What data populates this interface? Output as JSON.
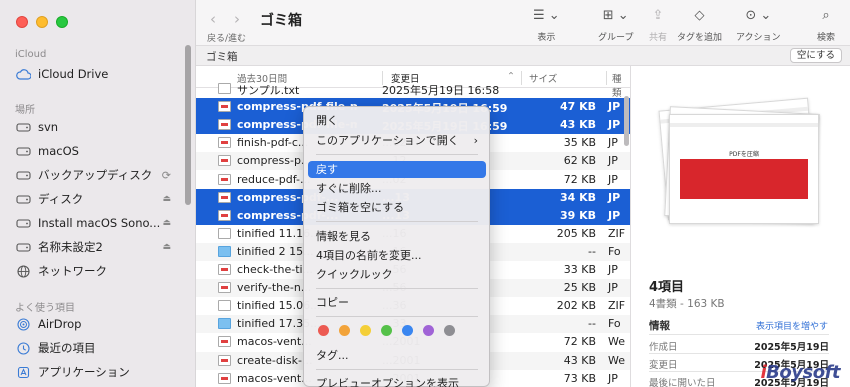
{
  "sidebar": {
    "sections": {
      "icloud": "iCloud",
      "places": "場所",
      "favorites": "よく使う項目"
    },
    "icloud_items": [
      {
        "label": "iCloud Drive",
        "icon": "cloud-icon"
      }
    ],
    "places_items": [
      {
        "label": "svn",
        "icon": "drive-icon"
      },
      {
        "label": "macOS",
        "icon": "drive-icon"
      },
      {
        "label": "バックアップディスク",
        "icon": "drive-icon"
      },
      {
        "label": "ディスク",
        "icon": "drive-icon"
      },
      {
        "label": "Install macOS Sono...",
        "icon": "drive-icon"
      },
      {
        "label": "名称未設定2",
        "icon": "drive-icon"
      },
      {
        "label": "ネットワーク",
        "icon": "globe-icon"
      }
    ],
    "favorites_items": [
      {
        "label": "AirDrop",
        "icon": "airdrop-icon"
      },
      {
        "label": "最近の項目",
        "icon": "clock-icon"
      },
      {
        "label": "アプリケーション",
        "icon": "apps-icon"
      }
    ]
  },
  "toolbar": {
    "nav_label": "戻る/進む",
    "title": "ゴミ箱",
    "view_label": "表示",
    "group_label": "グループ",
    "share_label": "共有",
    "add_tag_label": "タグを追加",
    "action_label": "アクション",
    "search_label": "検索"
  },
  "pathbar": {
    "path": "ゴミ箱",
    "empty_button": "空にする"
  },
  "list": {
    "columns": {
      "name": "過去30日間",
      "date": "変更日",
      "size": "サイズ",
      "kind": "種類"
    },
    "rows": [
      {
        "name": "サンプル.txt",
        "date": "2025年5月19日 16:58",
        "size": "",
        "kind": "",
        "icon": "text",
        "state": "clip"
      },
      {
        "name": "compress-pdf-file-mac.jpg",
        "date": "2025年5月19日 16:59",
        "size": "47 KB",
        "kind": "JP",
        "icon": "img",
        "state": "selected"
      },
      {
        "name": "compress-pdf-file-mac2.jpg",
        "date": "2025年5月19日 16:59",
        "size": "43 KB",
        "kind": "JP",
        "icon": "img",
        "state": "selected"
      },
      {
        "name": "finish-pdf-c...",
        "date": "...02",
        "size": "35 KB",
        "kind": "JP",
        "icon": "img",
        "state": ""
      },
      {
        "name": "compress-p...",
        "date": "...12",
        "size": "62 KB",
        "kind": "JP",
        "icon": "img",
        "state": "alt"
      },
      {
        "name": "reduce-pdf-...",
        "date": "...02",
        "size": "72 KB",
        "kind": "JP",
        "icon": "img",
        "state": ""
      },
      {
        "name": "compress-pdf-...",
        "date": "...13",
        "size": "34 KB",
        "kind": "JP",
        "icon": "img",
        "state": "selected"
      },
      {
        "name": "compress-pdf-...",
        "date": "...13",
        "size": "39 KB",
        "kind": "JP",
        "icon": "img",
        "state": "selected"
      },
      {
        "name": "tinified 11.16...",
        "date": "...16",
        "size": "205 KB",
        "kind": "ZIF",
        "icon": "text",
        "state": ""
      },
      {
        "name": "tinified 2 15...",
        "date": "...16",
        "size": "--",
        "kind": "Fo",
        "icon": "folder",
        "state": "alt"
      },
      {
        "name": "check-the-ti...",
        "date": "...56",
        "size": "33 KB",
        "kind": "JP",
        "icon": "img",
        "state": ""
      },
      {
        "name": "verify-the-n...",
        "date": "...56",
        "size": "25 KB",
        "kind": "JP",
        "icon": "img",
        "state": "alt"
      },
      {
        "name": "tinified 15.06...",
        "date": "...36",
        "size": "202 KB",
        "kind": "ZIF",
        "icon": "text",
        "state": ""
      },
      {
        "name": "tinified 17.35...",
        "date": "...33",
        "size": "--",
        "kind": "Fo",
        "icon": "folder",
        "state": "alt"
      },
      {
        "name": "macos-vent...",
        "date": "...2001",
        "size": "72 KB",
        "kind": "We",
        "icon": "img",
        "state": ""
      },
      {
        "name": "create-disk-...",
        "date": "...2001",
        "size": "43 KB",
        "kind": "We",
        "icon": "img",
        "state": "alt"
      },
      {
        "name": "macos-vent...",
        "date": "...2001",
        "size": "73 KB",
        "kind": "JP",
        "icon": "img",
        "state": ""
      }
    ]
  },
  "context_menu": {
    "items": [
      {
        "label": "開く"
      },
      {
        "label": "このアプリケーションで開く",
        "submenu": true
      },
      {
        "label": "戻す",
        "active": true
      },
      {
        "label": "すぐに削除..."
      },
      {
        "label": "ゴミ箱を空にする"
      },
      {
        "label": "情報を見る"
      },
      {
        "label": "4項目の名前を変更..."
      },
      {
        "label": "クイックルック"
      },
      {
        "label": "コピー"
      },
      {
        "label": "タグ..."
      },
      {
        "label": "プレビューオプションを表示"
      }
    ],
    "tag_colors": [
      "#ec5a52",
      "#f2a33a",
      "#f4cf38",
      "#55c149",
      "#3a86f0",
      "#a063d6",
      "#8e8e93"
    ]
  },
  "preview": {
    "stack_caption": "PDFを圧縮",
    "title": "4項目",
    "subtitle": "4書類 - 163 KB",
    "info_label": "情報",
    "more_link": "表示項目を増やす",
    "rows": [
      {
        "label": "作成日",
        "value": "2025年5月19日"
      },
      {
        "label": "変更日",
        "value": "2025年5月19日"
      },
      {
        "label": "最後に開いた日",
        "value": "2025年5月19日"
      }
    ]
  },
  "watermark": {
    "i": "i",
    "boy": "Boy",
    "soft": "soft"
  }
}
